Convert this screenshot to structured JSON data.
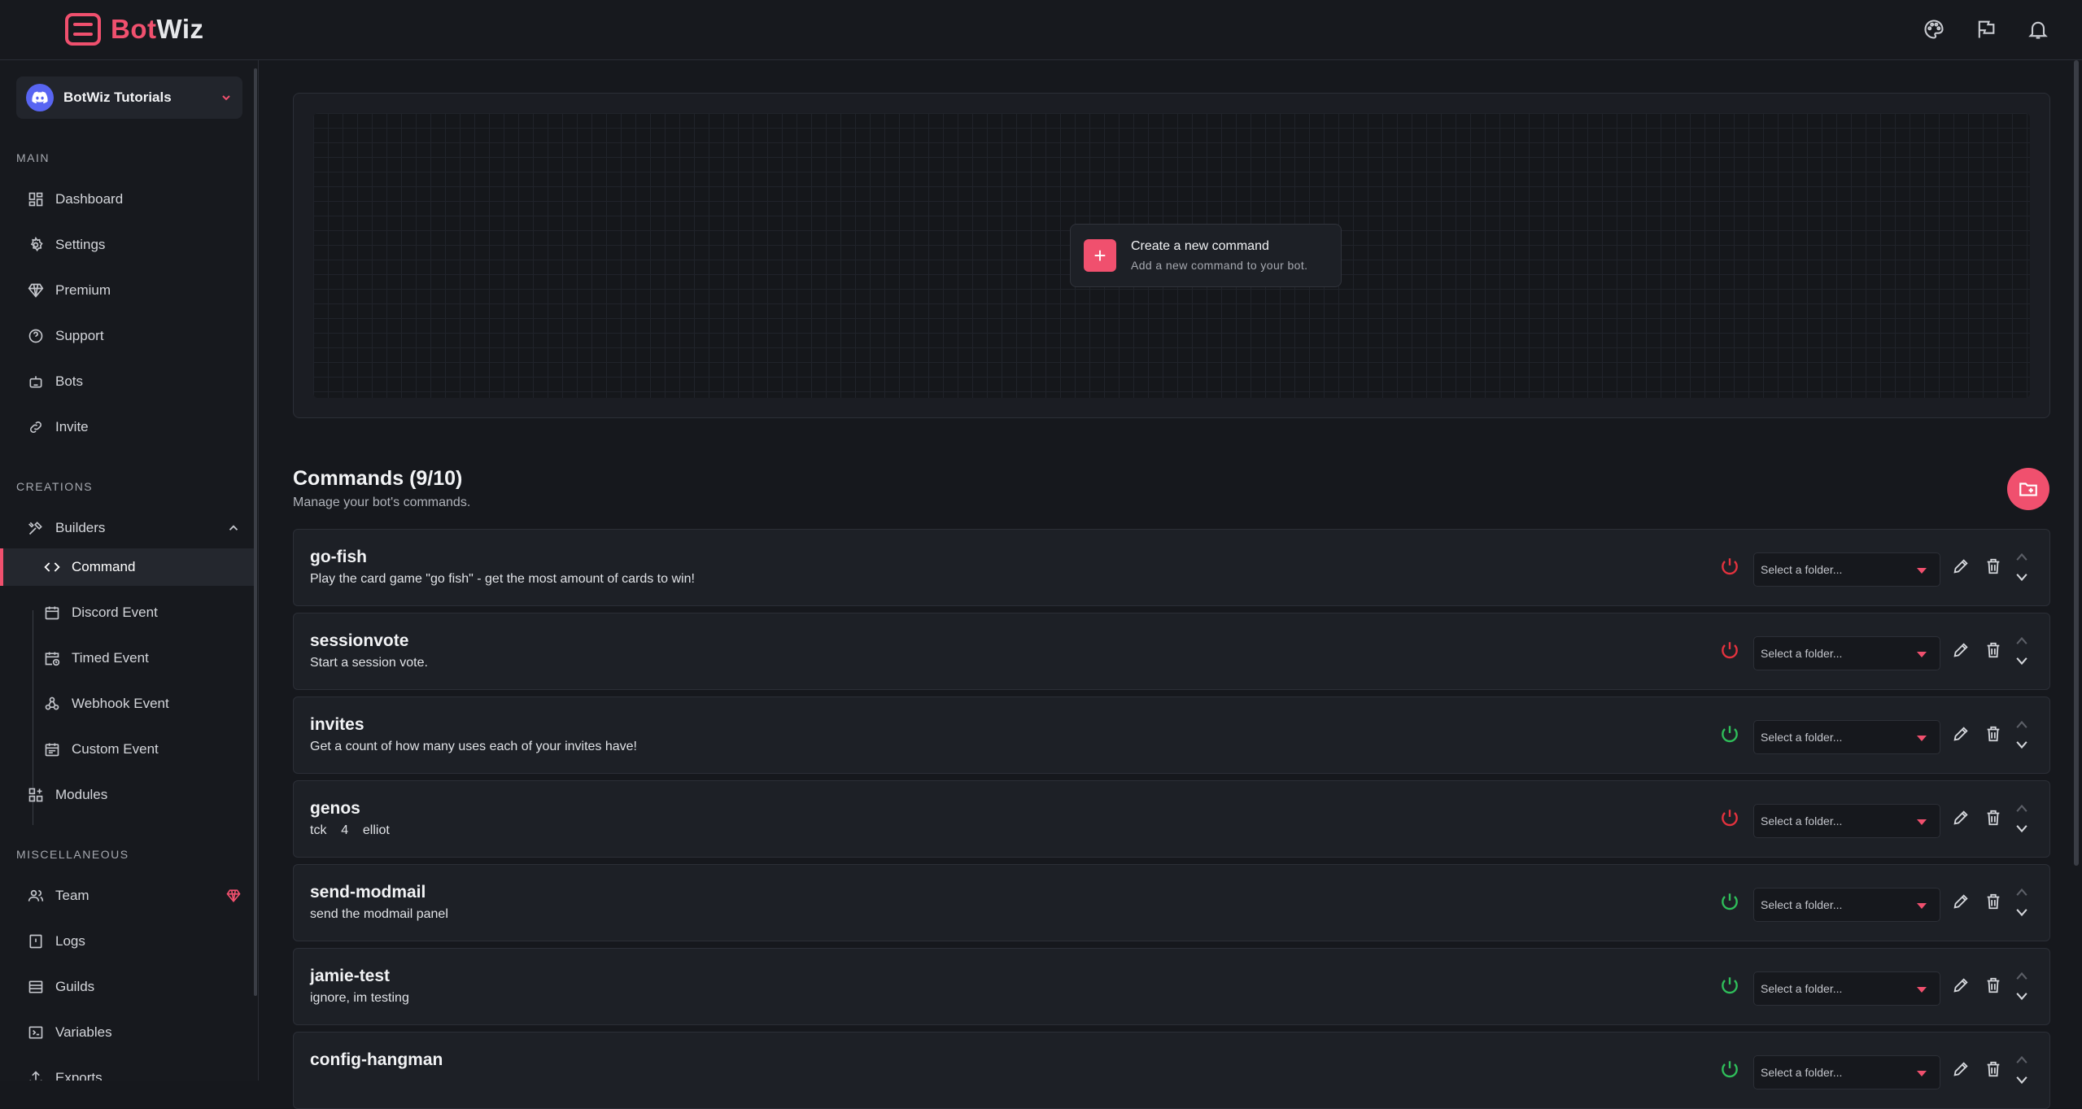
{
  "brand": {
    "part1": "Bot",
    "part2": "Wiz"
  },
  "topbar_icons": [
    "palette-icon",
    "flag-icon",
    "bell-icon"
  ],
  "server": {
    "name": "BotWiz Tutorials"
  },
  "sidebar": {
    "main_label": "MAIN",
    "main_items": [
      {
        "label": "Dashboard",
        "icon": "dashboard-icon"
      },
      {
        "label": "Settings",
        "icon": "gear-icon"
      },
      {
        "label": "Premium",
        "icon": "diamond-icon"
      },
      {
        "label": "Support",
        "icon": "help-icon"
      },
      {
        "label": "Bots",
        "icon": "robot-icon"
      },
      {
        "label": "Invite",
        "icon": "link-icon"
      }
    ],
    "creations_label": "CREATIONS",
    "builders": {
      "label": "Builders",
      "icon": "tools-icon"
    },
    "builder_items": [
      {
        "label": "Command",
        "icon": "code-icon",
        "active": true
      },
      {
        "label": "Discord Event",
        "icon": "calendar-icon"
      },
      {
        "label": "Timed Event",
        "icon": "calendar-clock-icon"
      },
      {
        "label": "Webhook Event",
        "icon": "webhook-icon"
      },
      {
        "label": "Custom Event",
        "icon": "calendar-list-icon"
      }
    ],
    "modules": {
      "label": "Modules",
      "icon": "modules-icon"
    },
    "misc_label": "MISCELLANEOUS",
    "misc_items": [
      {
        "label": "Team",
        "icon": "team-icon",
        "premium": true
      },
      {
        "label": "Logs",
        "icon": "logs-icon"
      },
      {
        "label": "Guilds",
        "icon": "guilds-icon"
      },
      {
        "label": "Variables",
        "icon": "variables-icon"
      },
      {
        "label": "Exports",
        "icon": "exports-icon"
      }
    ]
  },
  "hero": {
    "create_title": "Create a new command",
    "create_sub": "Add a new command to your bot."
  },
  "commands": {
    "title": "Commands (9/10)",
    "subtitle": "Manage your bot's commands.",
    "folder_placeholder": "Select a folder...",
    "items": [
      {
        "name": "go-fish",
        "description": "Play the card game \"go fish\" - get the most amount of cards to win!",
        "enabled": false
      },
      {
        "name": "sessionvote",
        "description": "Start a session vote.",
        "enabled": false
      },
      {
        "name": "invites",
        "description": "Get a count of how many uses each of your invites have!",
        "enabled": true
      },
      {
        "name": "genos",
        "description": "tck    4    elliot",
        "enabled": false
      },
      {
        "name": "send-modmail",
        "description": "send the modmail panel",
        "enabled": true
      },
      {
        "name": "jamie-test",
        "description": "ignore, im testing",
        "enabled": true
      },
      {
        "name": "config-hangman",
        "description": "",
        "enabled": true
      }
    ]
  },
  "colors": {
    "accent": "#f0506e",
    "enabled": "#2fbf5a",
    "disabled": "#e5323e",
    "background": "#16181d"
  }
}
